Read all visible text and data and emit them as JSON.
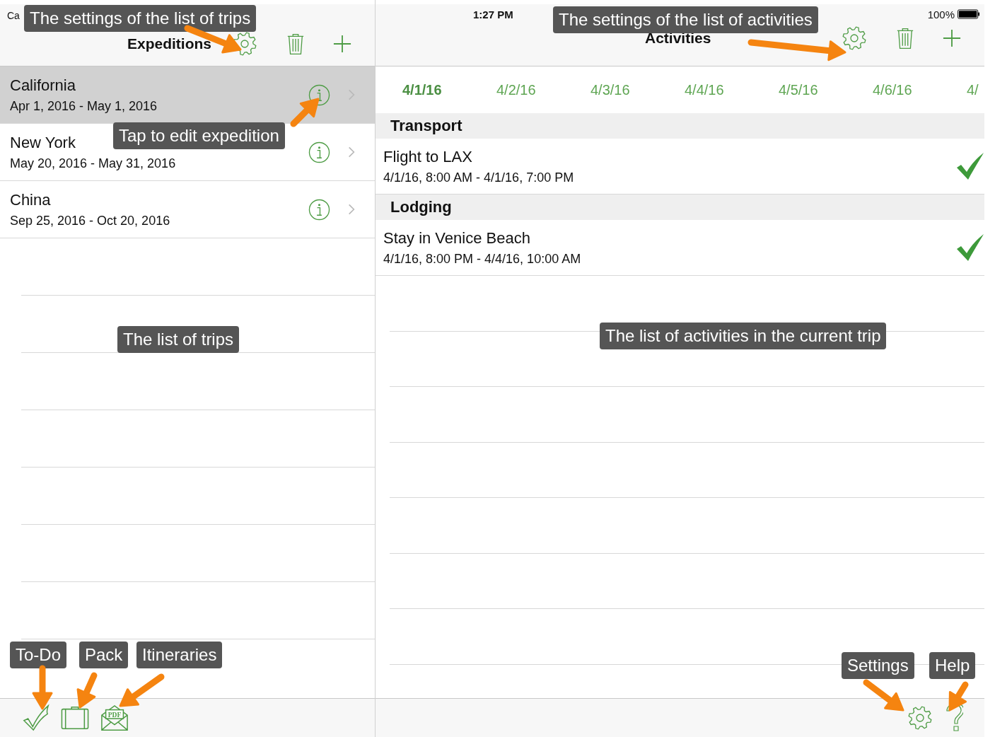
{
  "status_bar": {
    "carrier": "Ca",
    "time": "1:27 PM",
    "battery": "100%"
  },
  "trips_pane": {
    "title": "Expeditions",
    "trips": [
      {
        "name": "California",
        "dates": "Apr 1, 2016 - May 1, 2016",
        "selected": true
      },
      {
        "name": "New York",
        "dates": "May 20, 2016 - May 31, 2016",
        "selected": false
      },
      {
        "name": "China",
        "dates": "Sep 25, 2016 - Oct 20, 2016",
        "selected": false
      }
    ],
    "toolbar": {
      "pdf_label": "PDF"
    }
  },
  "activities_pane": {
    "title": "Activities",
    "dates": [
      {
        "label": "4/1/16",
        "selected": true
      },
      {
        "label": "4/2/16",
        "selected": false
      },
      {
        "label": "4/3/16",
        "selected": false
      },
      {
        "label": "4/4/16",
        "selected": false
      },
      {
        "label": "4/5/16",
        "selected": false
      },
      {
        "label": "4/6/16",
        "selected": false
      },
      {
        "label": "4/",
        "selected": false
      }
    ],
    "sections": [
      {
        "title": "Transport",
        "items": [
          {
            "name": "Flight to LAX",
            "time": "4/1/16, 8:00 AM - 4/1/16, 7:00 PM",
            "done": true
          }
        ]
      },
      {
        "title": "Lodging",
        "items": [
          {
            "name": "Stay in Venice Beach",
            "time": "4/1/16, 8:00 PM - 4/4/16, 10:00 AM",
            "done": true
          }
        ]
      }
    ]
  },
  "annotations": [
    {
      "text": "The settings of the list of trips"
    },
    {
      "text": "Tap to edit expedition"
    },
    {
      "text": "The list of trips"
    },
    {
      "text": "The settings of the list of activities"
    },
    {
      "text": "The list of activities in the current trip"
    },
    {
      "text": "To-Do"
    },
    {
      "text": "Pack"
    },
    {
      "text": "Itineraries"
    },
    {
      "text": "Settings"
    },
    {
      "text": "Help"
    }
  ]
}
